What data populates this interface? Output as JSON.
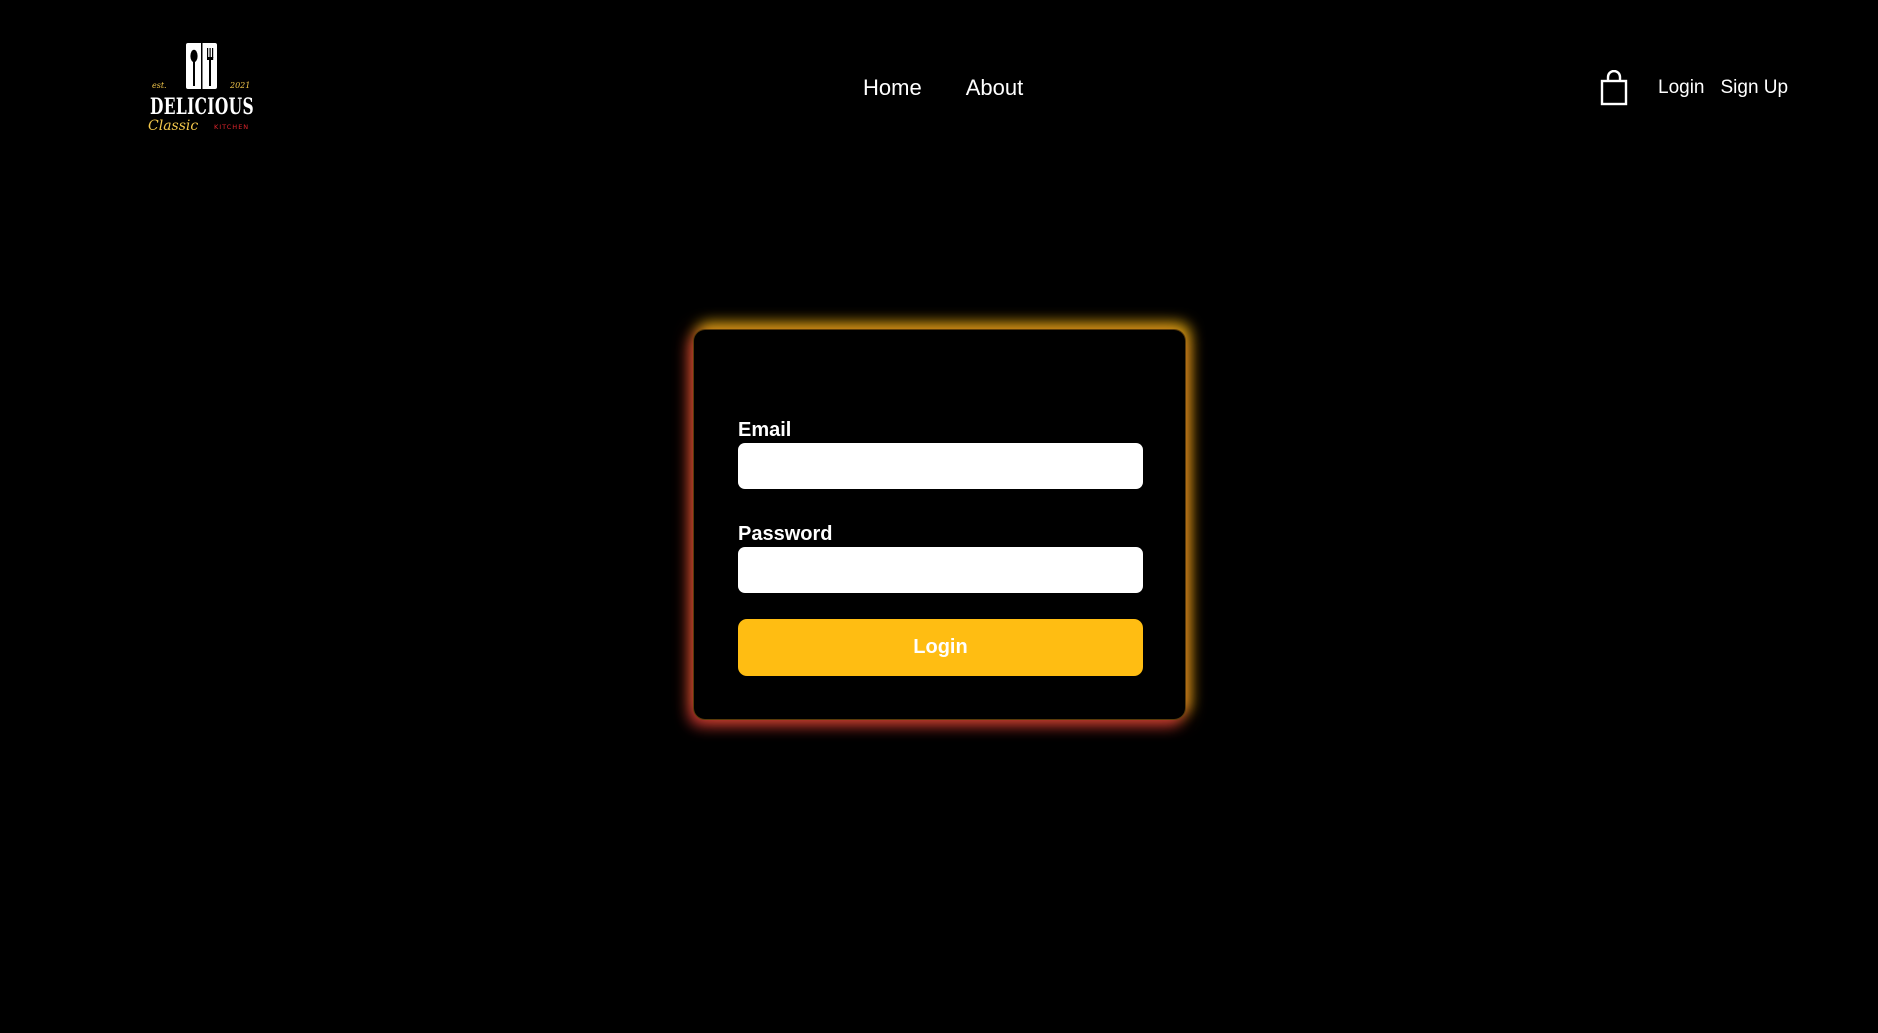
{
  "brand": {
    "logo_text": "DELICIOUS",
    "logo_script": "Classic",
    "logo_subtext": "KITCHEN",
    "logo_est": "est.",
    "logo_year": "2021",
    "colors": {
      "gold": "#f3c74b",
      "red": "#e0252c"
    }
  },
  "nav": {
    "home": "Home",
    "about": "About"
  },
  "header_right": {
    "cart_icon": "shopping-bag-icon",
    "login": "Login",
    "signup": "Sign Up"
  },
  "login_form": {
    "email_label": "Email",
    "email_value": "",
    "password_label": "Password",
    "password_value": "",
    "submit_label": "Login"
  },
  "colors": {
    "background": "#000000",
    "accent": "#ffbd12",
    "glow_top": "#ffc814",
    "glow_bottom": "#dc323c"
  }
}
